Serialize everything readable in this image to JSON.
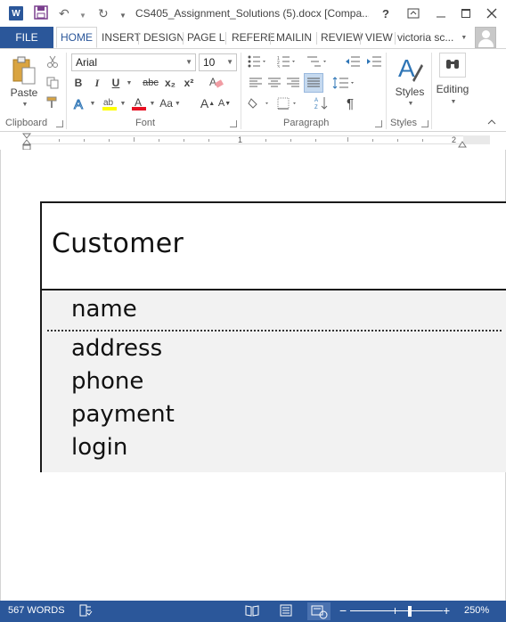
{
  "title_bar": {
    "app_icon_letter": "W",
    "document_title": "CS405_Assignment_Solutions (5).docx [Compa...",
    "help": "?"
  },
  "tabs": {
    "file": "FILE",
    "items": [
      "HOME",
      "INSERT",
      "DESIGN",
      "PAGE L",
      "REFERE",
      "MAILIN",
      "REVIEW",
      "VIEW"
    ],
    "active": "HOME",
    "user_name": "victoria sc..."
  },
  "ribbon": {
    "clipboard": {
      "paste_label": "Paste",
      "group_label": "Clipboard"
    },
    "font": {
      "font_name": "Arial",
      "font_size": "10",
      "bold": "B",
      "italic": "I",
      "underline": "U",
      "strike": "abc",
      "subscript": "x₂",
      "superscript": "x²",
      "grow": "A",
      "shrink": "A",
      "change_case": "Aa",
      "group_label": "Font"
    },
    "paragraph": {
      "pilcrow": "¶",
      "group_label": "Paragraph"
    },
    "styles": {
      "label": "Styles",
      "group_label": "Styles"
    },
    "editing": {
      "label": "Editing"
    }
  },
  "ruler": {
    "marks": [
      "1",
      "2"
    ]
  },
  "document": {
    "class_name": "Customer",
    "attributes": [
      "name",
      "address",
      "phone",
      "payment",
      "login"
    ]
  },
  "status_bar": {
    "word_count": "567 WORDS",
    "zoom_minus": "−",
    "zoom_plus": "+",
    "zoom_level": "250%"
  },
  "colors": {
    "accent": "#2b579a",
    "uml_fill": "#f2f2f2"
  }
}
